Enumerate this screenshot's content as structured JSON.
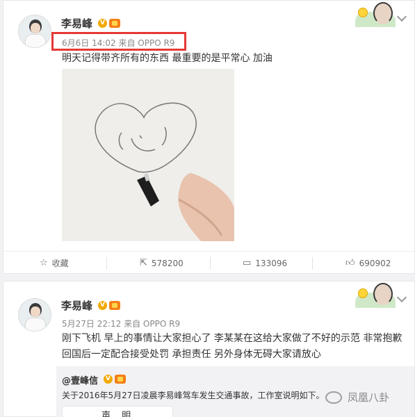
{
  "post1": {
    "author": "李易峰",
    "verified_badge": "V",
    "meta": "6月6日 14:02 来自 OPPO R9",
    "text": "明天记得带齐所有的东西 最重要的是平常心 加油",
    "photo_icon": "heart-drawing-image",
    "actions": {
      "favorite_label": "收藏",
      "repost_count": "578200",
      "comment_count": "133096",
      "like_count": "690902"
    },
    "highlight_color": "#e53935"
  },
  "post2": {
    "author": "李易峰",
    "verified_badge": "V",
    "meta": "5月27日 22:12 来自 OPPO R9",
    "text_line1": "刚下飞机 早上的事情让大家担心了 李某某在这给大家做了不好的示范 非常抱歉",
    "text_line2": "回国后一定配合接受处罚 承担责任  另外身体无碍大家请放心",
    "quote": {
      "author": "@壹峰信",
      "verified_badge": "V",
      "text": "关于2016年5月27日凌晨李易峰驾车发生交通事故，工作室说明如下。",
      "title": "声 明"
    }
  },
  "watermark": "凤凰八卦",
  "colors": {
    "accent_orange": "#f2a900",
    "text": "#333333",
    "meta": "#888888"
  }
}
